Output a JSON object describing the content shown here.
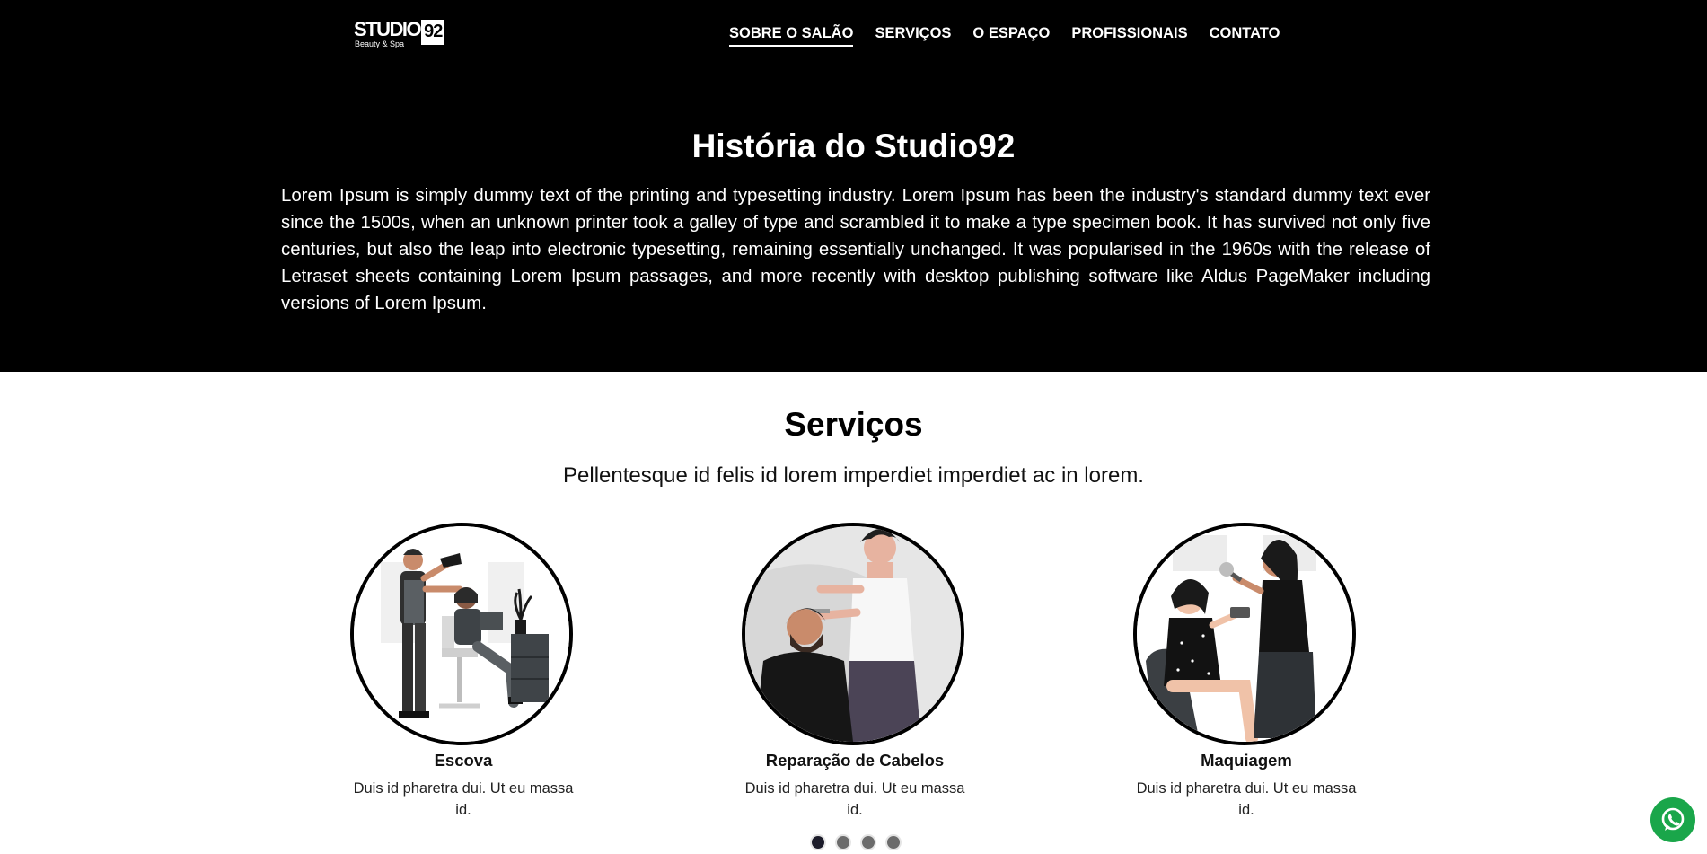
{
  "nav": {
    "logo_main": "STUDIO",
    "logo_num": "92",
    "logo_sub": "Beauty & Spa",
    "items": [
      {
        "label": "SOBRE O SALÃO",
        "active": true
      },
      {
        "label": "SERVIÇOS",
        "active": false
      },
      {
        "label": "O ESPAÇO",
        "active": false
      },
      {
        "label": "PROFISSIONAIS",
        "active": false
      },
      {
        "label": "CONTATO",
        "active": false
      }
    ]
  },
  "hero": {
    "title": "História do Studio92",
    "text": "Lorem Ipsum is simply dummy text of the printing and typesetting industry. Lorem Ipsum has been the industry's standard dummy text ever since the 1500s, when an unknown printer took a galley of type and scrambled it to make a type specimen book. It has survived not only five centuries, but also the leap into electronic typesetting, remaining essentially unchanged. It was popularised in the 1960s with the release of Letraset sheets containing Lorem Ipsum passages, and more recently with desktop publishing software like Aldus PageMaker including versions of Lorem Ipsum."
  },
  "services": {
    "title": "Serviços",
    "subtitle": "Pellentesque id felis id lorem imperdiet imperdiet ac in lorem.",
    "cards": [
      {
        "title": "Escova",
        "desc": "Duis id pharetra dui. Ut eu massa id.",
        "icon": "blow-dry-illustration"
      },
      {
        "title": "Reparação de Cabelos",
        "desc": "Duis id pharetra dui. Ut eu massa id.",
        "icon": "haircut-illustration"
      },
      {
        "title": "Maquiagem",
        "desc": "Duis id pharetra dui. Ut eu massa id.",
        "icon": "makeup-illustration"
      }
    ]
  },
  "carousel": {
    "total_slides": 4,
    "active_index": 0
  },
  "whatsapp": {
    "icon": "whatsapp-icon",
    "color": "#1aa64a"
  },
  "colors": {
    "hero_bg": "#000000",
    "page_bg": "#ffffff",
    "dot_active": "#1c1c2a",
    "dot_inactive": "#6b6b6b"
  }
}
